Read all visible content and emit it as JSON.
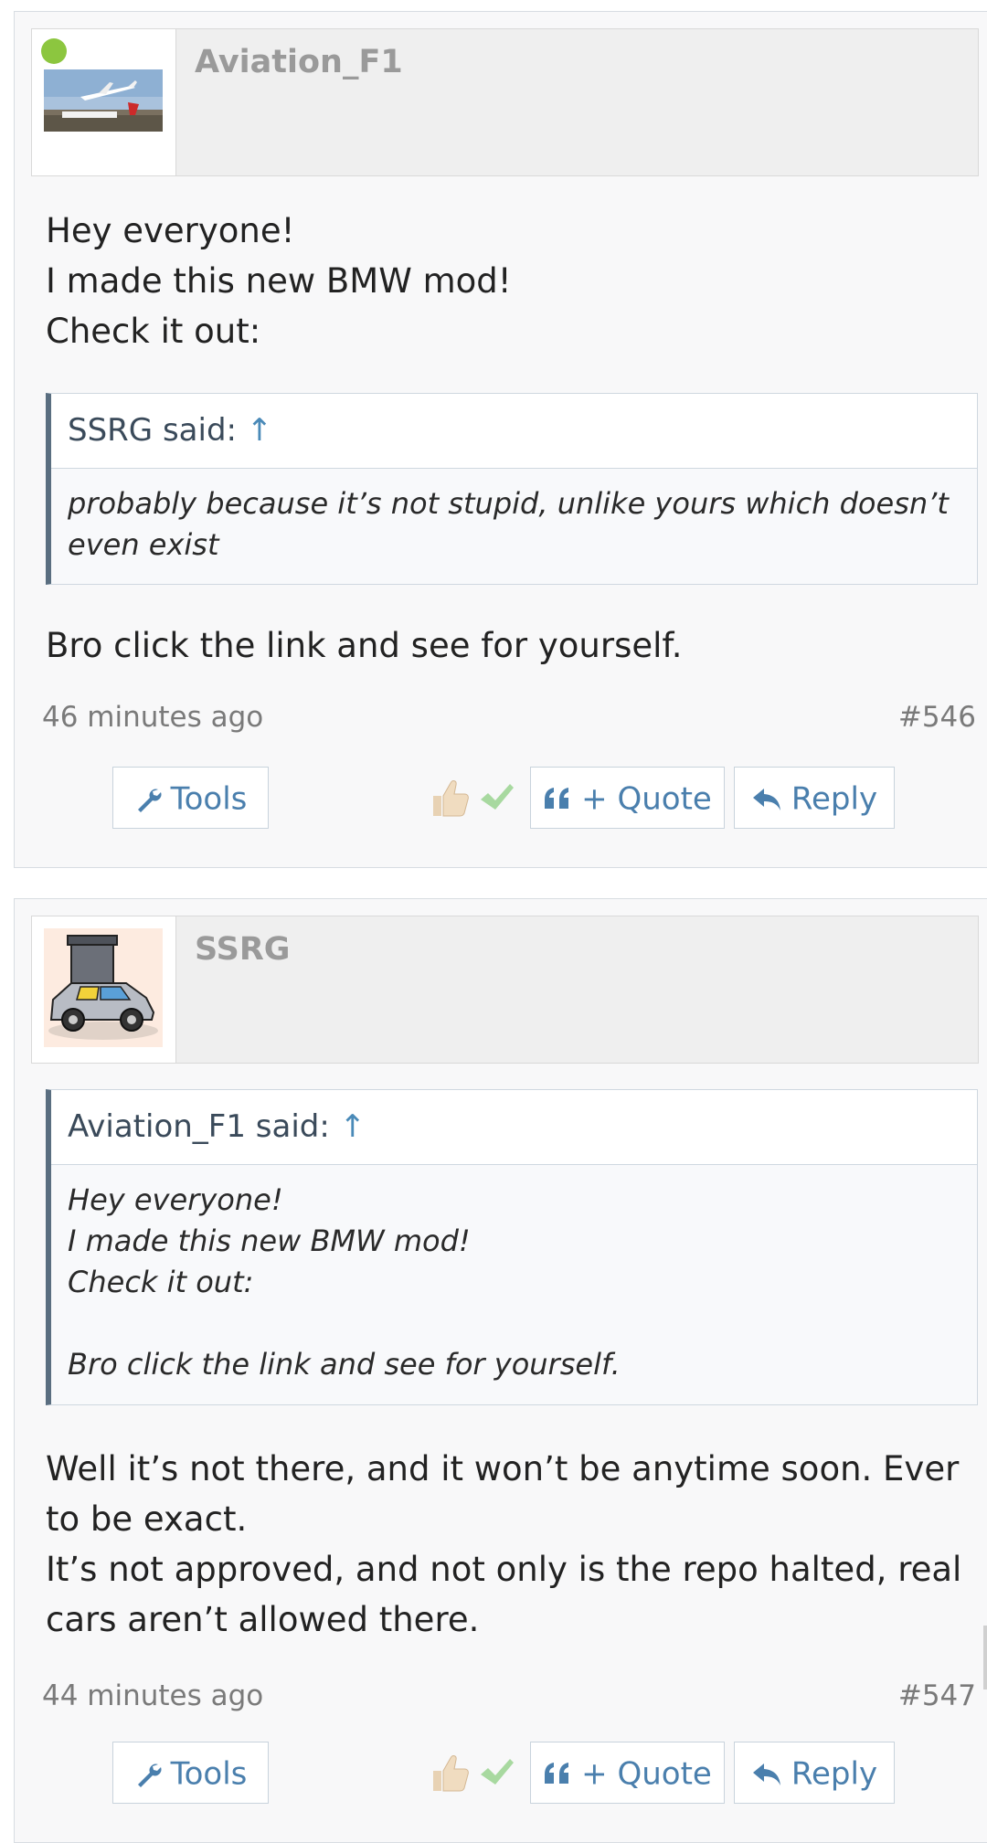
{
  "posts": [
    {
      "username": "Aviation_F1",
      "online": true,
      "avatar": "airplane-takeoff-photo",
      "message_lines": [
        "Hey everyone!",
        "I made this new BMW mod!",
        "Check it out:"
      ],
      "quote": {
        "author_label": "SSRG said:",
        "arrow": "↑",
        "text": "probably because it’s not stupid, unlike yours which doesn’t even exist"
      },
      "reply_text": "Bro click the link and see for yourself.",
      "time": "46 minutes ago",
      "post_number": "#546"
    },
    {
      "username": "SSRG",
      "online": false,
      "avatar": "cartoon-car-crushed-drawing",
      "quote": {
        "author_label": "Aviation_F1 said:",
        "arrow": "↑",
        "lines": [
          "Hey everyone!",
          "I made this new BMW mod!",
          "Check it out:",
          "",
          "Bro click the link and see for yourself."
        ]
      },
      "message_lines": [
        "Well it’s not there, and it won’t be anytime soon. Ever",
        "to be exact.",
        "It’s not approved, and not only is the repo halted, real",
        "cars aren’t allowed there."
      ],
      "time": "44 minutes ago",
      "post_number": "#547"
    }
  ],
  "actions": {
    "tools_label": "Tools",
    "quote_label": "+ Quote",
    "reply_label": "Reply"
  },
  "colors": {
    "link": "#4a7fad",
    "online": "#8cc63f",
    "quote_border": "#5a6e80"
  },
  "icons": [
    "wrench-icon",
    "thumbs-up-icon",
    "check-icon",
    "quote-marks-icon",
    "reply-arrow-icon"
  ]
}
